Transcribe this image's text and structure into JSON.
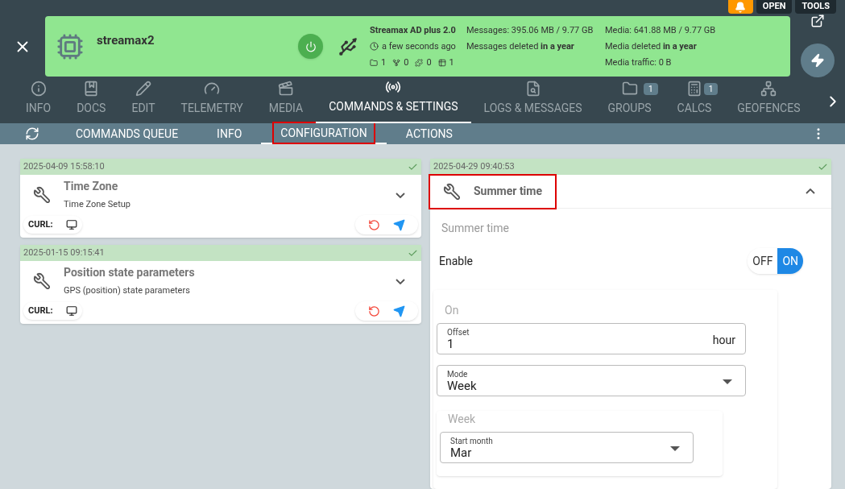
{
  "top_buttons": [
    {
      "kind": "bell"
    },
    {
      "kind": "text",
      "label": "OPEN"
    },
    {
      "kind": "text",
      "label": "TOOLS"
    }
  ],
  "device": {
    "name": "streamax2",
    "model": "Streamax AD plus 2.0",
    "last_seen": "a few seconds ago",
    "counters": [
      {
        "kind": "folder",
        "value": "1"
      },
      {
        "kind": "branch",
        "value": "0"
      },
      {
        "kind": "puzzle",
        "value": "0"
      },
      {
        "kind": "grid",
        "value": "1"
      }
    ],
    "messages": "Messages: 395.06 MB / 9.77 GB",
    "messages_deleted": "Messages deleted **in a year**",
    "media": "Media: 641.88 MB / 9.77 GB",
    "media_deleted": "Media deleted **in a year**",
    "media_traffic": "Media traffic: 0 B",
    "power_on": true
  },
  "tabs": [
    {
      "label": "INFO",
      "selected": false
    },
    {
      "label": "DOCS",
      "selected": false
    },
    {
      "label": "EDIT",
      "selected": false
    },
    {
      "label": "TELEMETRY",
      "selected": false
    },
    {
      "label": "MEDIA",
      "selected": false
    },
    {
      "label": "COMMANDS & SETTINGS",
      "selected": true
    },
    {
      "label": "LOGS & MESSAGES",
      "selected": false
    },
    {
      "label": "GROUPS",
      "selected": false,
      "badge": "1"
    },
    {
      "label": "CALCS",
      "selected": false,
      "badge": "1"
    },
    {
      "label": "GEOFENCES",
      "selected": false
    }
  ],
  "subtabs": [
    {
      "label": "COMMANDS QUEUE",
      "selected": false,
      "highlighted": false
    },
    {
      "label": "INFO",
      "selected": false,
      "highlighted": false
    },
    {
      "label": "CONFIGURATION",
      "selected": true,
      "highlighted": true
    },
    {
      "label": "ACTIONS",
      "selected": false,
      "highlighted": false
    }
  ],
  "cards": [
    {
      "timestamp": "2025-04-09 15:58:10",
      "title": "Time Zone",
      "subtitle": "Time Zone Setup",
      "curl": "CURL:",
      "expanded": false
    },
    {
      "timestamp": "2025-01-15 09:15:41",
      "title": "Position state parameters",
      "subtitle": "GPS (position) state parameters",
      "curl": "CURL:",
      "expanded": false
    }
  ],
  "open_card": {
    "timestamp": "2025-04-29 09:40:53",
    "title": "Summer time",
    "expanded": true,
    "highlighted": true,
    "section": "Summer time",
    "toggle": {
      "label": "Enable",
      "off_label": "OFF",
      "on_label": "ON",
      "on": true
    },
    "group": {
      "title": "On",
      "offset": {
        "label": "Offset",
        "value": "1",
        "unit": "hour"
      },
      "mode": {
        "label": "Mode",
        "value": "Week"
      },
      "subgroup": {
        "title": "Week",
        "start_month": {
          "label": "Start month",
          "value": "Mar"
        }
      }
    }
  }
}
